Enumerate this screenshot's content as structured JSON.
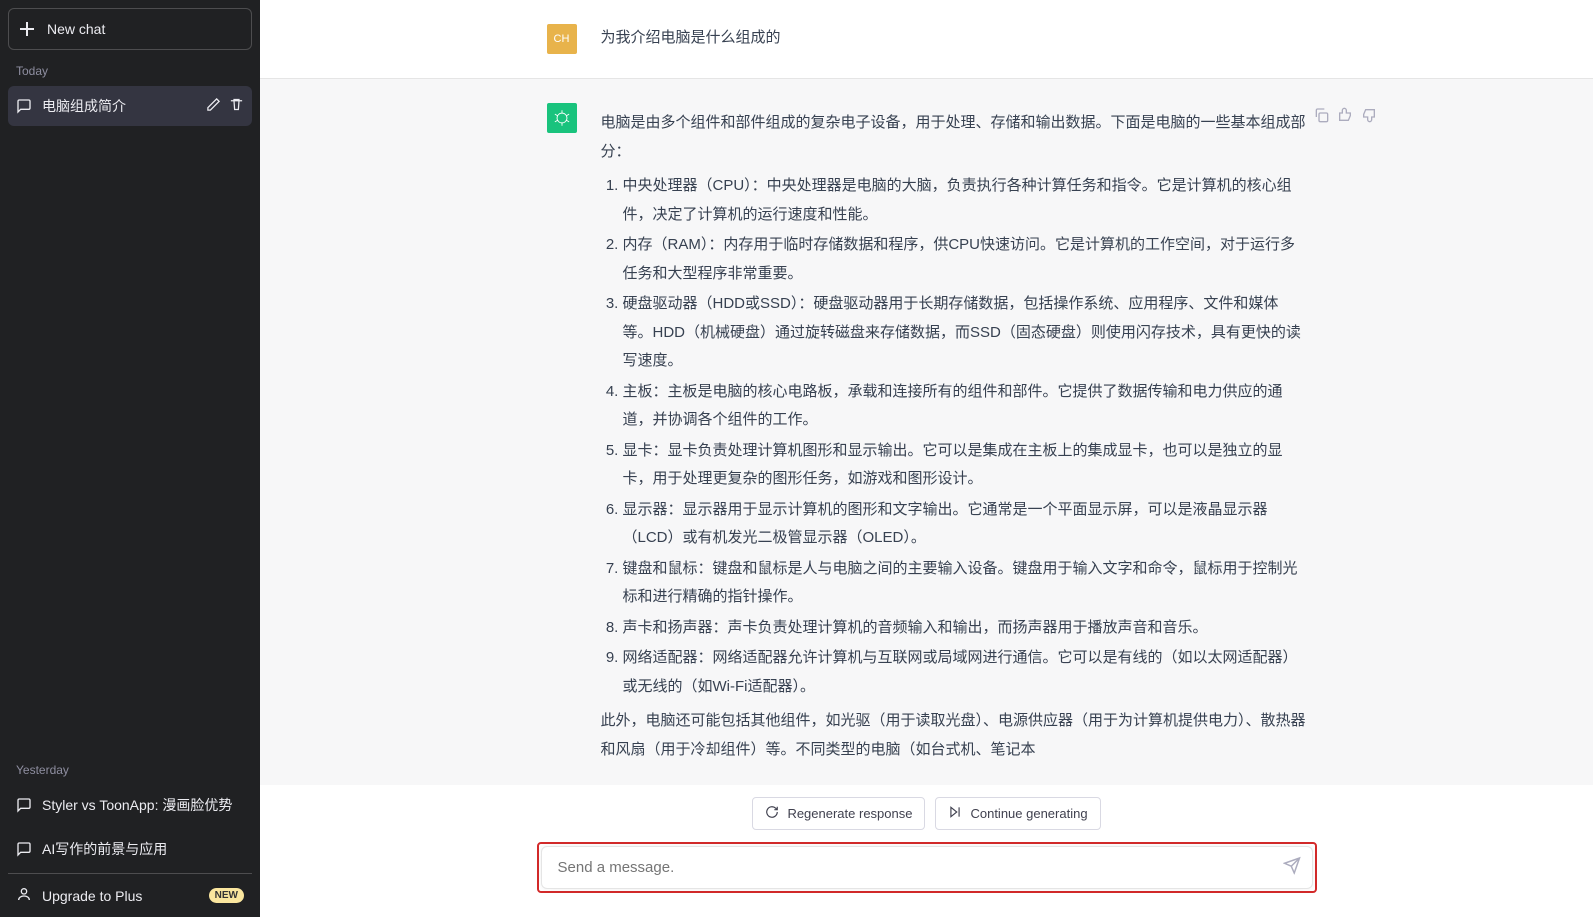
{
  "sidebar": {
    "new_chat": "New chat",
    "section_today": "Today",
    "section_yesterday": "Yesterday",
    "today_items": [
      {
        "title": "电脑组成简介"
      }
    ],
    "yesterday_items": [
      {
        "title": "Styler vs ToonApp: 漫画脸优势"
      },
      {
        "title": "AI写作的前景与应用"
      }
    ],
    "upgrade_label": "Upgrade to Plus",
    "upgrade_badge": "NEW"
  },
  "conversation": {
    "user_avatar": "CH",
    "user_message": "为我介绍电脑是什么组成的",
    "assistant_intro": "电脑是由多个组件和部件组成的复杂电子设备，用于处理、存储和输出数据。下面是电脑的一些基本组成部分：",
    "assistant_list": [
      "中央处理器（CPU）：中央处理器是电脑的大脑，负责执行各种计算任务和指令。它是计算机的核心组件，决定了计算机的运行速度和性能。",
      "内存（RAM）：内存用于临时存储数据和程序，供CPU快速访问。它是计算机的工作空间，对于运行多任务和大型程序非常重要。",
      "硬盘驱动器（HDD或SSD）：硬盘驱动器用于长期存储数据，包括操作系统、应用程序、文件和媒体等。HDD（机械硬盘）通过旋转磁盘来存储数据，而SSD（固态硬盘）则使用闪存技术，具有更快的读写速度。",
      "主板：主板是电脑的核心电路板，承载和连接所有的组件和部件。它提供了数据传输和电力供应的通道，并协调各个组件的工作。",
      "显卡：显卡负责处理计算机图形和显示输出。它可以是集成在主板上的集成显卡，也可以是独立的显卡，用于处理更复杂的图形任务，如游戏和图形设计。",
      "显示器：显示器用于显示计算机的图形和文字输出。它通常是一个平面显示屏，可以是液晶显示器（LCD）或有机发光二极管显示器（OLED）。",
      "键盘和鼠标：键盘和鼠标是人与电脑之间的主要输入设备。键盘用于输入文字和命令，鼠标用于控制光标和进行精确的指针操作。",
      "声卡和扬声器：声卡负责处理计算机的音频输入和输出，而扬声器用于播放声音和音乐。",
      "网络适配器：网络适配器允许计算机与互联网或局域网进行通信。它可以是有线的（如以太网适配器）或无线的（如Wi-Fi适配器）。"
    ],
    "assistant_outro": "此外，电脑还可能包括其他组件，如光驱（用于读取光盘）、电源供应器（用于为计算机提供电力）、散热器和风扇（用于冷却组件）等。不同类型的电脑（如台式机、笔记本"
  },
  "footer": {
    "regenerate": "Regenerate response",
    "continue": "Continue generating",
    "placeholder": "Send a message."
  }
}
